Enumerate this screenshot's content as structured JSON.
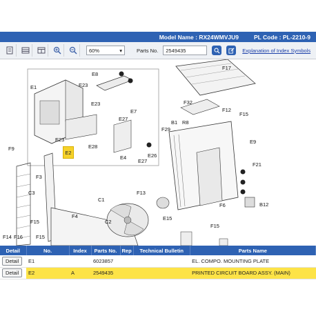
{
  "title_bar": {
    "model_label": "Model Name : RX24WMVJU9",
    "plcode_label": "PL Code : PL-2210-9"
  },
  "toolbar": {
    "zoom_value": "60%",
    "parts_no_label": "Parts No.",
    "parts_no_value": "2549435",
    "explain_link": "Explanation of Index Symbols"
  },
  "diagram": {
    "highlighted_label": "E2",
    "labels": {
      "e1": "E1",
      "e8": "E8",
      "e23a": "E23",
      "e23b": "E23",
      "e23c": "E23",
      "e7": "E7",
      "e27a": "E27",
      "e27b": "E27",
      "e28": "E28",
      "e4": "E4",
      "e26": "E26",
      "f17": "F17",
      "f32": "F32",
      "f12": "F12",
      "f15a": "F15",
      "b1": "B1",
      "f29": "F29",
      "r8": "R8",
      "e9": "E9",
      "f21": "F21",
      "f9": "F9",
      "f3": "F3",
      "c3": "C3",
      "c1": "C1",
      "f13": "F13",
      "f4": "F4",
      "c2": "C2",
      "e15": "E15",
      "f6": "F6",
      "b12": "B12",
      "f15b": "F15",
      "f15c": "F15",
      "f14": "F14",
      "f16": "F16",
      "f15d": "F15"
    }
  },
  "table": {
    "headers": [
      "Detail",
      "No.",
      "Index",
      "Parts No.",
      "Rep",
      "Technical Bulletin",
      "Parts Name"
    ],
    "rows": [
      {
        "detail": "Detail",
        "no": "E1",
        "index": "",
        "parts_no": "6023857",
        "rep": "",
        "bulletin": "",
        "name": "EL. COMPO. MOUNTING PLATE"
      },
      {
        "detail": "Detail",
        "no": "E2",
        "index": "A",
        "parts_no": "2549435",
        "rep": "",
        "bulletin": "",
        "name": "PRINTED CIRCUIT BOARD ASSY. (MAIN)"
      }
    ]
  },
  "colors": {
    "header_blue": "#2e62b3",
    "highlight_yellow": "#fde347"
  }
}
